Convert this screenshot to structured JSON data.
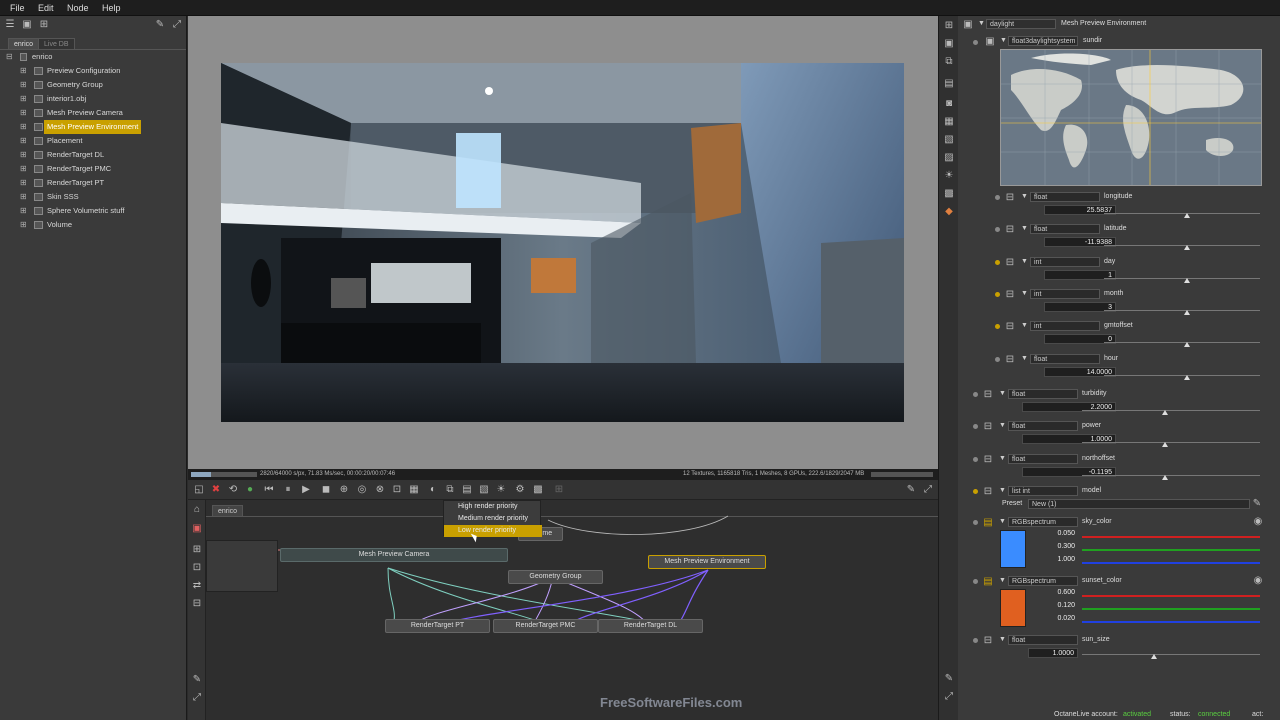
{
  "menu": [
    "File",
    "Edit",
    "Node",
    "Help"
  ],
  "left_panel": {
    "tabs": [
      "enrico",
      "Live DB"
    ],
    "root": "enrico",
    "items": [
      {
        "label": "Preview Configuration",
        "selected": false
      },
      {
        "label": "Geometry Group",
        "selected": false
      },
      {
        "label": "interior1.obj",
        "selected": false
      },
      {
        "label": "Mesh Preview Camera",
        "selected": false
      },
      {
        "label": "Mesh Preview Environment",
        "selected": true
      },
      {
        "label": "Placement",
        "selected": false
      },
      {
        "label": "RenderTarget DL",
        "selected": false
      },
      {
        "label": "RenderTarget PMC",
        "selected": false
      },
      {
        "label": "RenderTarget PT",
        "selected": false
      },
      {
        "label": "Skin SSS",
        "selected": false
      },
      {
        "label": "Sphere Volumetric stuff",
        "selected": false
      },
      {
        "label": "Volume",
        "selected": false
      }
    ]
  },
  "render_status": {
    "left": "2820/64000 s/px, 71.83 Ms/sec, 00:00:20/00:07:46",
    "right": "12 Textures, 1165818 Tris, 1 Meshes, 8 GPUs, 222.6/1829/2047 MB"
  },
  "graph": {
    "tab": "enrico",
    "context_menu": [
      "High render priority",
      "Medium render priority",
      "Low render priority"
    ],
    "nodes": {
      "camera": "Mesh Preview Camera",
      "volume": "Volume",
      "geometry": "Geometry Group",
      "environment": "Mesh Preview Environment",
      "rt_pt": "RenderTarget PT",
      "rt_pmc": "RenderTarget PMC",
      "rt_dl": "RenderTarget DL"
    }
  },
  "right_panel": {
    "header_select": "daylight",
    "header_title": "Mesh Preview Environment",
    "sub_select": "float3daylightsystem",
    "sub_title": "sundir",
    "params": [
      {
        "type": "float",
        "name": "longitude",
        "value": "25.5837",
        "dot": "#888"
      },
      {
        "type": "float",
        "name": "latitude",
        "value": "-11.9388",
        "dot": "#888"
      },
      {
        "type": "int",
        "name": "day",
        "value": "1",
        "dot": "#c9a000"
      },
      {
        "type": "int",
        "name": "month",
        "value": "3",
        "dot": "#c9a000"
      },
      {
        "type": "int",
        "name": "gmtoffset",
        "value": "0",
        "dot": "#c9a000"
      },
      {
        "type": "float",
        "name": "hour",
        "value": "14.0000",
        "dot": "#888"
      }
    ],
    "params2": [
      {
        "type": "float",
        "name": "turbidity",
        "value": "2.2000",
        "dot": "#888"
      },
      {
        "type": "float",
        "name": "power",
        "value": "1.0000",
        "dot": "#888"
      },
      {
        "type": "float",
        "name": "northoffset",
        "value": "-0.1195",
        "dot": "#888"
      }
    ],
    "model": {
      "type": "list int",
      "name": "model",
      "preset_label": "Preset",
      "preset_value": "New (1)"
    },
    "sky_color": {
      "type": "RGBspectrum",
      "name": "sky_color",
      "r": "0.050",
      "g": "0.300",
      "b": "1.000",
      "swatch": "#3a8cff"
    },
    "sunset_color": {
      "type": "RGBspectrum",
      "name": "sunset_color",
      "r": "0.600",
      "g": "0.120",
      "b": "0.020",
      "swatch": "#e06020"
    },
    "sun_size": {
      "type": "float",
      "name": "sun_size",
      "value": "1.0000"
    }
  },
  "bottom_status": {
    "account_label": "OctaneLive account:",
    "account_value": "activated",
    "status_label": "status:",
    "status_value": "connected",
    "act_label": "act:"
  },
  "watermark": "FreeSoftwareFiles.com"
}
